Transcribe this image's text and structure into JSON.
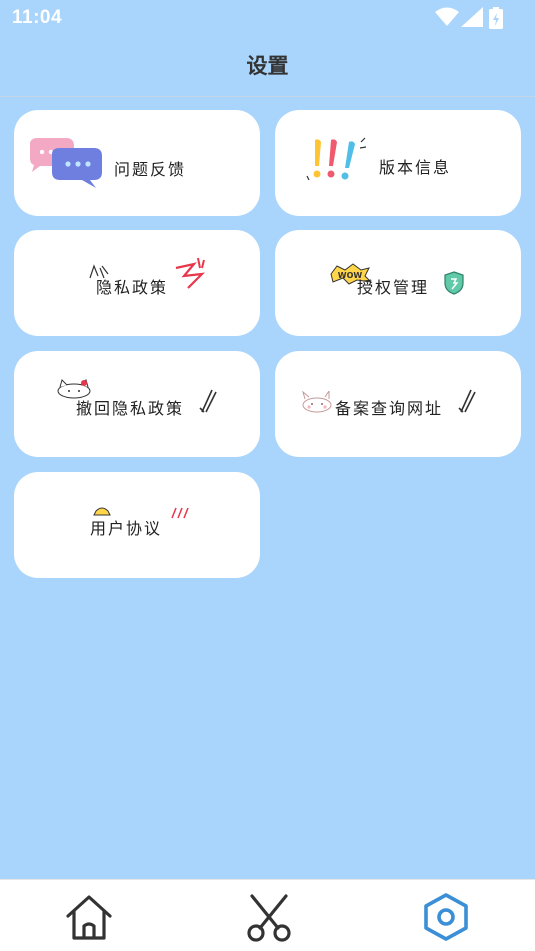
{
  "status_bar": {
    "time": "11:04"
  },
  "header": {
    "title": "设置"
  },
  "menu": {
    "feedback": "问题反馈",
    "version": "版本信息",
    "privacy": "隐私政策",
    "permissions": "授权管理",
    "revoke_privacy": "撤回隐私政策",
    "filing_lookup": "备案查询网址",
    "user_agreement": "用户协议"
  },
  "decorations": {
    "wow_sticker": "WOW"
  },
  "nav": {
    "active": "settings",
    "items": [
      "home",
      "scissors",
      "settings"
    ]
  },
  "colors": {
    "background": "#a9d4fb",
    "card": "#ffffff",
    "nav_active": "#3a8fd6",
    "nav_inactive": "#333333"
  }
}
